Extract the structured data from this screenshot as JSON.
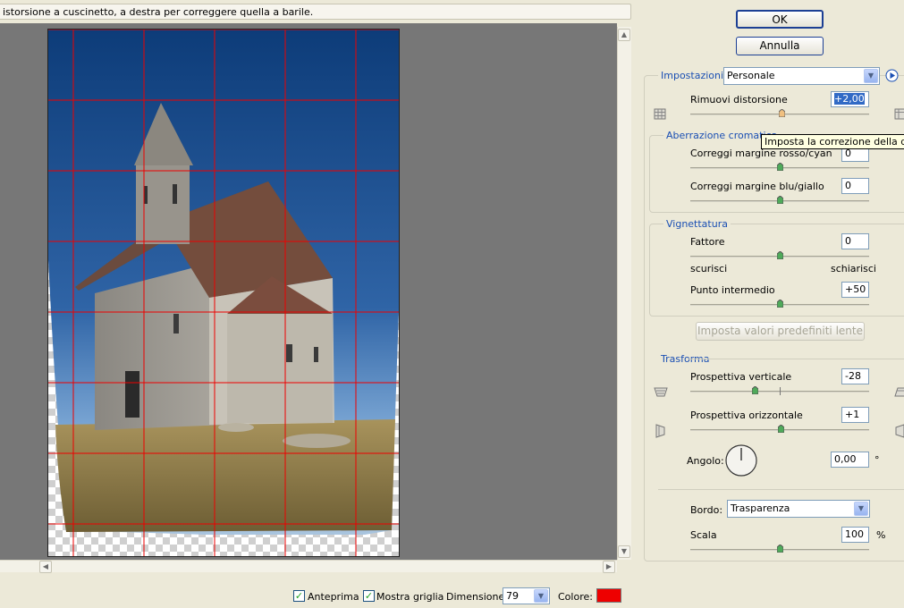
{
  "hint_text": "istorsione a cuscinetto, a destra per correggere quella a barile.",
  "buttons": {
    "ok": "OK",
    "cancel": "Annulla",
    "lens_defaults": "Imposta valori predefiniti lente"
  },
  "settings": {
    "label": "Impostazioni:",
    "value": "Personale"
  },
  "remove_distortion": {
    "label": "Rimuovi distorsione",
    "value": "+2,00",
    "level": 2.0,
    "range": [
      -100,
      100
    ]
  },
  "tooltip": "Imposta la correzione della distorsione",
  "chromatic": {
    "title": "Aberrazione cromatica",
    "red_cyan": {
      "label": "Correggi margine rosso/cyan",
      "value": "0"
    },
    "blue_yellow": {
      "label": "Correggi margine blu/giallo",
      "value": "0"
    }
  },
  "vignette": {
    "title": "Vignettatura",
    "amount": {
      "label": "Fattore",
      "value": "0"
    },
    "darken": "scurisci",
    "lighten": "schiarisci",
    "midpoint": {
      "label": "Punto intermedio",
      "value": "+50"
    }
  },
  "transform": {
    "title": "Trasforma",
    "vertical": {
      "label": "Prospettiva verticale",
      "value": "-28",
      "level": -28,
      "range": [
        -100,
        100
      ]
    },
    "horizontal": {
      "label": "Prospettiva orizzontale",
      "value": "+1",
      "level": 1,
      "range": [
        -100,
        100
      ]
    },
    "angle": {
      "label": "Angolo:",
      "value": "0,00",
      "unit": "°"
    },
    "edge": {
      "label": "Bordo:",
      "value": "Trasparenza"
    },
    "scale": {
      "label": "Scala",
      "value": "100",
      "unit": "%"
    }
  },
  "bottom": {
    "preview": "Anteprima",
    "show_grid": "Mostra griglia",
    "size_label": "Dimensione:",
    "size_value": "79",
    "color_label": "Colore:",
    "grid_color": "#ee0000"
  },
  "colors": {
    "accent": "#1a4fb3",
    "sky_top": "#0e3f7e",
    "sky_bottom": "#6f9fcf",
    "grass": "#8f7a45"
  },
  "icons": [
    "pincushion-icon",
    "barrel-icon",
    "info-arrow-icon",
    "vertical-perspective-icon",
    "horizontal-perspective-icon",
    "angle-dial-icon"
  ]
}
